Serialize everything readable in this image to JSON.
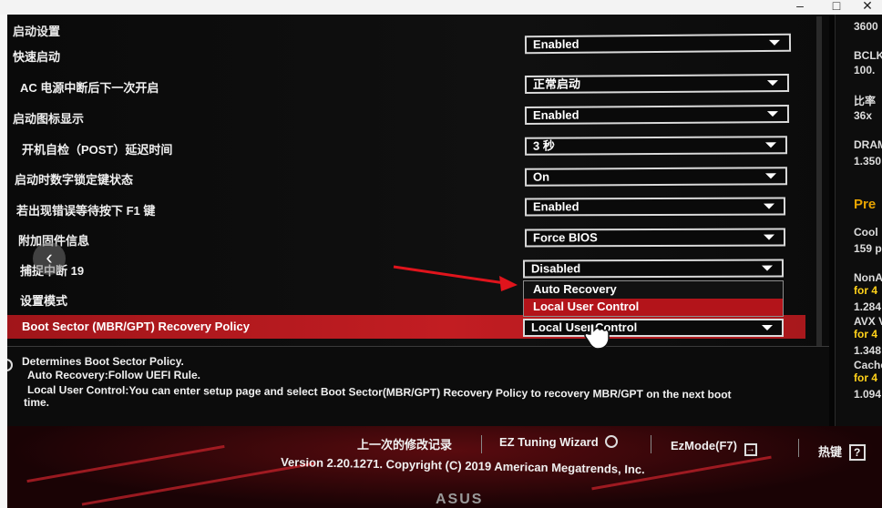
{
  "viewer": {
    "min": "–",
    "max": "□",
    "close": "✕"
  },
  "section_title": "启动设置",
  "rows": [
    {
      "label": "快速启动",
      "value": "Enabled"
    },
    {
      "label": "AC 电源中断后下一次开启",
      "value": "正常启动"
    },
    {
      "label": "启动图标显示",
      "value": "Enabled"
    },
    {
      "label": "开机自检（POST）延迟时间",
      "value": "3 秒"
    },
    {
      "label": "启动时数字锁定键状态",
      "value": "On"
    },
    {
      "label": "若出现错误等待按下 F1 键",
      "value": "Enabled"
    },
    {
      "label": "附加固件信息",
      "value": "Force BIOS"
    },
    {
      "label": "捕捉中断 19",
      "value": "Disabled"
    },
    {
      "label": "设置模式",
      "value": ""
    }
  ],
  "highlight": {
    "label": "Boot Sector (MBR/GPT) Recovery Policy",
    "value": "Local User Control"
  },
  "popup": {
    "options": [
      "Auto Recovery",
      "Local User Control"
    ],
    "selected": "Local User Control"
  },
  "help": {
    "line1": "Determines Boot Sector Policy.",
    "line2": "Auto Recovery:Follow UEFI Rule.",
    "line3": "Local User Control:You can enter setup page and select Boot Sector(MBR/GPT) Recovery Policy to recovery MBR/GPT on the next boot",
    "line4": "time."
  },
  "right_panel": {
    "items": [
      "3600",
      "BCLK",
      "100.",
      "比率",
      "36x",
      "DRAM",
      "1.350",
      "Pre",
      "Cool",
      "159 p",
      "NonA",
      "for 4",
      "1.284",
      "AVX V",
      "for 4",
      "1.348",
      "Cache",
      "for 4",
      "1.094"
    ]
  },
  "footer": {
    "last_changes": "上一次的修改记录",
    "ez_tuning": "EZ Tuning Wizard",
    "ez_mode": "EzMode(F7)",
    "hotkeys": "热键",
    "version": "Version 2.20.1271. Copyright (C) 2019 American Megatrends, Inc.",
    "logo": "ASUS"
  },
  "colors": {
    "accent_red": "#c21d22",
    "highlight_yellow": "#ffd21a",
    "orange_title": "#e8a400"
  }
}
